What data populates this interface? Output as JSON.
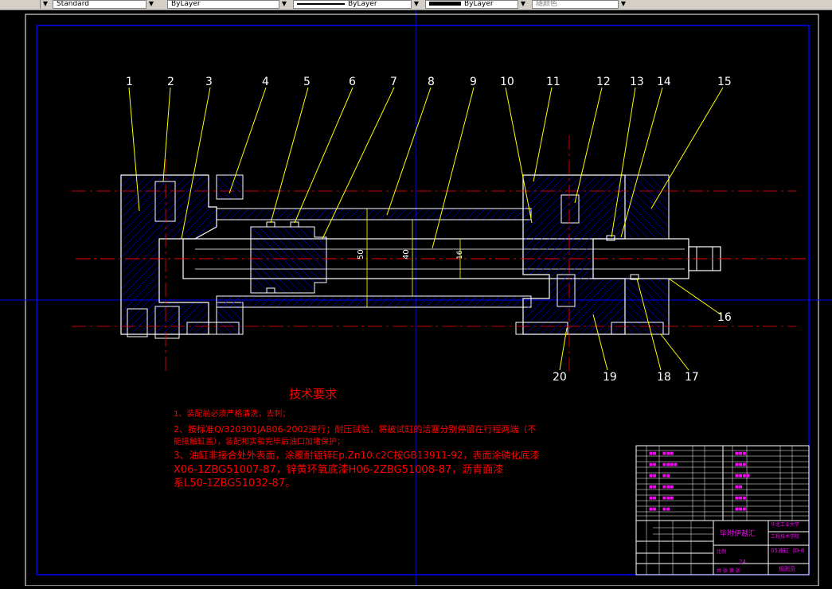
{
  "toolbar": {
    "text_style": "Standard",
    "layer_color": "ByLayer",
    "linetype": "ByLayer",
    "lineweight": "ByLayer",
    "plot_style": "随颜色"
  },
  "callouts": [
    "1",
    "2",
    "3",
    "4",
    "5",
    "6",
    "7",
    "8",
    "9",
    "10",
    "11",
    "12",
    "13",
    "14",
    "15",
    "16",
    "17",
    "18",
    "19",
    "20"
  ],
  "dimensions": {
    "d1": "50",
    "d2": "40",
    "d3": "16"
  },
  "tech": {
    "title": "技术要求",
    "line1": "1、装配前必须严格清洗，去刺；",
    "line2a": "2、按标准Q/320301JAB06-2002进行；耐压试验，将被试缸的活塞分别停留在行程两端（不",
    "line2b": "能接触缸盖），装配和实验完毕后油口加堵保护；",
    "line3a": "3、油缸非接合处外表面，涂覆耐镀锌Ep.Zn10.c2C按GB13911-92，表面涂磷化底漆",
    "line3b": "X06-1ZBG51007-87，锌黄环氧底漆H06-2ZBG51008-87，沥青面漆",
    "line3c": "系L50-1ZBG51032-87。"
  },
  "title_block": {
    "designer": "毕附伊越汇",
    "school_1": "华北工业大学",
    "school_2": "工程技术学院",
    "drawing_name": "05液缸（D-8",
    "scale_label": "比例",
    "sheet_label": "共  张 第  张",
    "sheet_no": "24",
    "sig": "规则员"
  },
  "colors": {
    "outline": "#ffffff",
    "border": "#0000ff",
    "hatch": "#0000ff",
    "leader": "#ffff00",
    "text_red": "#ff0000",
    "center": "#ff0000",
    "bom_text": "#ff00ff"
  }
}
